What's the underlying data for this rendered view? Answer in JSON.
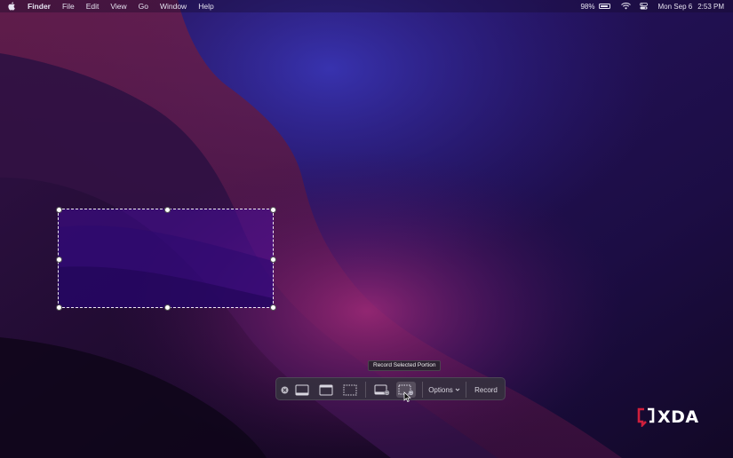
{
  "menubar": {
    "app_name": "Finder",
    "items": [
      "File",
      "Edit",
      "View",
      "Go",
      "Window",
      "Help"
    ],
    "status": {
      "battery_percent": "98%",
      "battery_level": 0.98,
      "date": "Mon Sep 6",
      "time": "2:53 PM"
    }
  },
  "tooltip": {
    "text": "Record Selected Portion"
  },
  "toolbar": {
    "close_icon": "close-icon",
    "icons": [
      "capture-entire-screen-icon",
      "capture-window-icon",
      "capture-selected-portion-icon",
      "record-entire-screen-icon",
      "record-selected-portion-icon"
    ],
    "active_tool": "record-selected-portion",
    "options_label": "Options",
    "record_label": "Record"
  },
  "watermark": {
    "text": "XDA"
  },
  "colors": {
    "wallpaper_base": "#1a0c3a",
    "selection_fill": "#4a0fb0",
    "toolbar_bg": "#34303e"
  }
}
